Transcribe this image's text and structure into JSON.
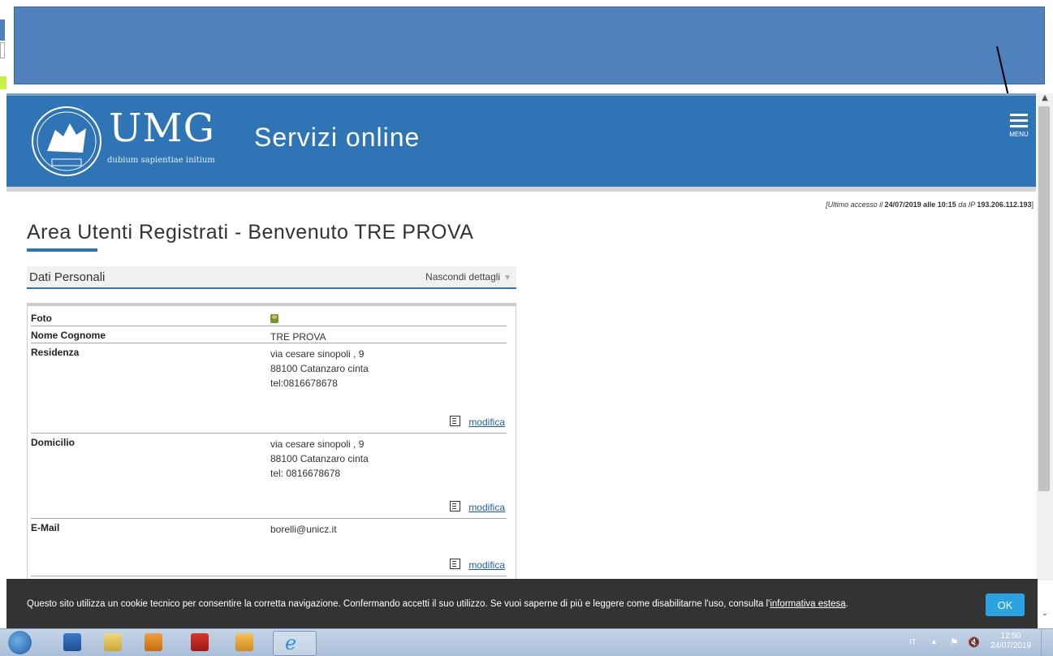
{
  "header": {
    "logo_text": "UMG",
    "logo_motto": "dubium sapientiae initium",
    "site_title": "Servizi online",
    "menu_label": "MENU"
  },
  "last_access": {
    "prefix": "[Ultimo accesso il ",
    "date_time": "24/07/2019 alle 10:15",
    "ip_prefix": " da IP ",
    "ip": "193.206.112.193",
    "suffix": "]"
  },
  "page": {
    "title": "Area Utenti Registrati - Benvenuto TRE PROVA"
  },
  "section": {
    "title": "Dati Personali",
    "toggle_label": "Nascondi dettagli"
  },
  "personal_data": {
    "foto_label": "Foto",
    "name_label": "Nome Cognome",
    "name_value": "TRE PROVA",
    "residence_label": "Residenza",
    "residence_line1": "via cesare sinopoli , 9",
    "residence_line2": "88100 Catanzaro cinta",
    "residence_line3": "tel:0816678678",
    "domicile_label": "Domicilio",
    "domicile_line1": "via cesare sinopoli , 9",
    "domicile_line2": "88100 Catanzaro cinta",
    "domicile_line3": "tel: 0816678678",
    "email_label": "E-Mail",
    "email_value": "borelli@unicz.it",
    "edit_label": "modifica"
  },
  "cookie_bar": {
    "text": "Questo sito utilizza un cookie tecnico per consentire la corretta navigazione. Confermando accetti il suo utilizzo. Se vuoi saperne di più e leggere come disabilitarne l'uso, consulta l'",
    "link": "informativa estesa",
    "end": ".",
    "ok_label": "OK"
  },
  "taskbar": {
    "lang": "IT",
    "time": "12:50",
    "date": "24/07/2019",
    "pinned": [
      "windows-explorer-icon",
      "libraries-icon",
      "media-player-icon",
      "acrobat-icon",
      "outlook-icon",
      "internet-explorer-icon"
    ]
  },
  "colors": {
    "header_blue": "#2f74b5",
    "top_frame_blue": "#4f81bd",
    "cookie_bar": "#333333",
    "ok_button": "#2aa3e0",
    "link": "#1f5fa8"
  }
}
